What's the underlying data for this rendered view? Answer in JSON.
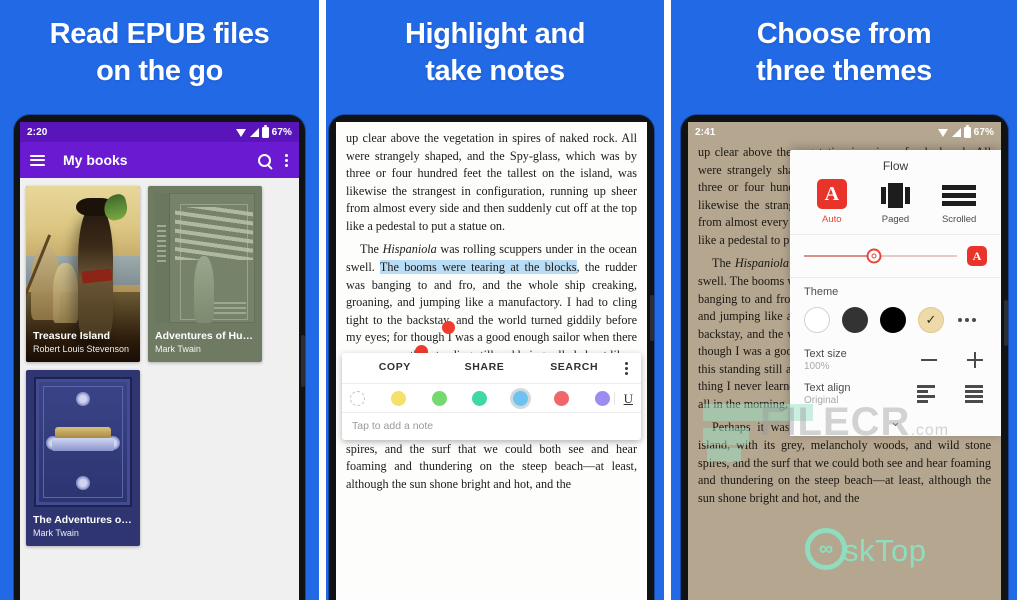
{
  "panels": [
    {
      "headline": [
        "Read EPUB files",
        "on the go"
      ],
      "status": {
        "time": "2:20",
        "battery": "67%"
      },
      "appbar": {
        "title": "My books"
      },
      "books": [
        {
          "title": "Treasure Island",
          "author": "Robert Louis Stevenson"
        },
        {
          "title": "Adventures of Huck...",
          "author": "Mark Twain"
        },
        {
          "title": "The Adventures of T...",
          "author": "Mark Twain"
        }
      ]
    },
    {
      "headline": [
        "Highlight and",
        "take notes"
      ],
      "reader": {
        "para1": "up clear above the vegetation in spires of naked rock. All were strangely shaped, and the Spy-glass, which was by three or four hundred feet the tallest on the island, was likewise the strangest in configuration, running up sheer from almost every side and then suddenly cut off at the top like a pedestal to put a statue on.",
        "para2_a": "The ",
        "para2_em": "Hispaniola",
        "para2_b": " was rolling scuppers under in the ocean swell. ",
        "para2_hl": "The booms were tearing at the blocks",
        "para2_c": ", the rudder was banging to and fro, and the whole ship creaking, groaning, and jumping like a manufactory. I had to cling tight to the backstay, and the world turned giddily before my eyes; for though I was a good enough sailor when there was way on, this standing still and being rolled about like a bottle was a thing I never learned to stand without a qualm or so, above all in the morning, on an empty stomach.",
        "para3": "Perhaps it was this—perhaps it was the look of the island, with its grey, melancholy woods, and wild stone spires, and the surf that we could both see and hear foaming and thundering on the steep beach—at least, although the sun shone bright and hot, and the"
      },
      "selection_menu": {
        "actions": [
          "COPY",
          "SHARE",
          "SEARCH"
        ],
        "note_placeholder": "Tap to add a note",
        "underline_glyph": "U",
        "swatches": [
          {
            "name": "none",
            "color": "transparent",
            "selected": false
          },
          {
            "name": "yellow",
            "color": "#f5e06a",
            "selected": false
          },
          {
            "name": "green",
            "color": "#74d96e",
            "selected": false
          },
          {
            "name": "teal",
            "color": "#3fd9a8",
            "selected": false
          },
          {
            "name": "blue",
            "color": "#6ec2f0",
            "selected": true
          },
          {
            "name": "red",
            "color": "#f0666a",
            "selected": false
          },
          {
            "name": "purple",
            "color": "#9b8df0",
            "selected": false
          }
        ]
      }
    },
    {
      "headline": [
        "Choose from",
        "three themes"
      ],
      "status": {
        "time": "2:41",
        "battery": "67%"
      },
      "reader": {
        "para1": "up clear above the vegetation in spires of naked rock. All were strangely shaped, and the Spy-glass, which was by three or four hundred feet the tallest on the island, was likewise the strangest in configuration, running up sheer from almost every side and then suddenly cut off at the top like a pedestal to put a statue on.",
        "para2_a": "The ",
        "para2_em": "Hispaniola",
        "para2_b": " was rolling scuppers under in the ocean swell. The booms were tearing at the blocks, the rudder was banging to and fro, and the whole ship creaking, groaning, and jumping like a manufactory. I had to cling tight to the backstay, and the world turned giddily before my eyes; for though I was a good enough sailor when there was way on, this standing still and being rolled about like a bottle was a thing I never learned to stand without a qualm or so, above all in the morning, on an empty stomach.",
        "para3": "Perhaps it was this—perhaps it was the look of the island, with its grey, melancholy woods, and wild stone spires, and the surf that we could both see and hear foaming and thundering on the steep beach—at least, although the sun shone bright and hot, and the"
      },
      "settings": {
        "flow_title": "Flow",
        "flow_options": [
          {
            "label": "Auto",
            "icon": "auto-a-icon",
            "active": true
          },
          {
            "label": "Paged",
            "icon": "paged-icon",
            "active": false
          },
          {
            "label": "Scrolled",
            "icon": "scrolled-icon",
            "active": false
          }
        ],
        "brightness": {
          "value_pct": 46,
          "auto_label": "A"
        },
        "theme": {
          "label": "Theme",
          "swatches": [
            {
              "name": "light",
              "color": "#ffffff",
              "selected": false
            },
            {
              "name": "gray",
              "color": "#333333",
              "selected": false
            },
            {
              "name": "black",
              "color": "#000000",
              "selected": false
            },
            {
              "name": "sepia",
              "color": "#eed9a8",
              "selected": true
            }
          ],
          "more_glyph": "•••"
        },
        "text_size": {
          "label": "Text size",
          "value": "100%",
          "minus": "−",
          "plus": "+"
        },
        "text_align": {
          "label": "Text align",
          "value": "Original"
        },
        "collapse_glyph": "⌄"
      }
    }
  ],
  "watermarks": {
    "filecr": "FILECR",
    "filecr_dotcom": ".com",
    "desktop": "skTop",
    "logo_glyph": "∞"
  },
  "colors": {
    "brand_blue": "#2269e6",
    "appbar_purple": "#6a1bd1",
    "statusbar_purple": "#5915ba",
    "highlight_blue": "#b9ddf5",
    "accent_red": "#e8342a",
    "sepia_page": "#b4a68f"
  }
}
